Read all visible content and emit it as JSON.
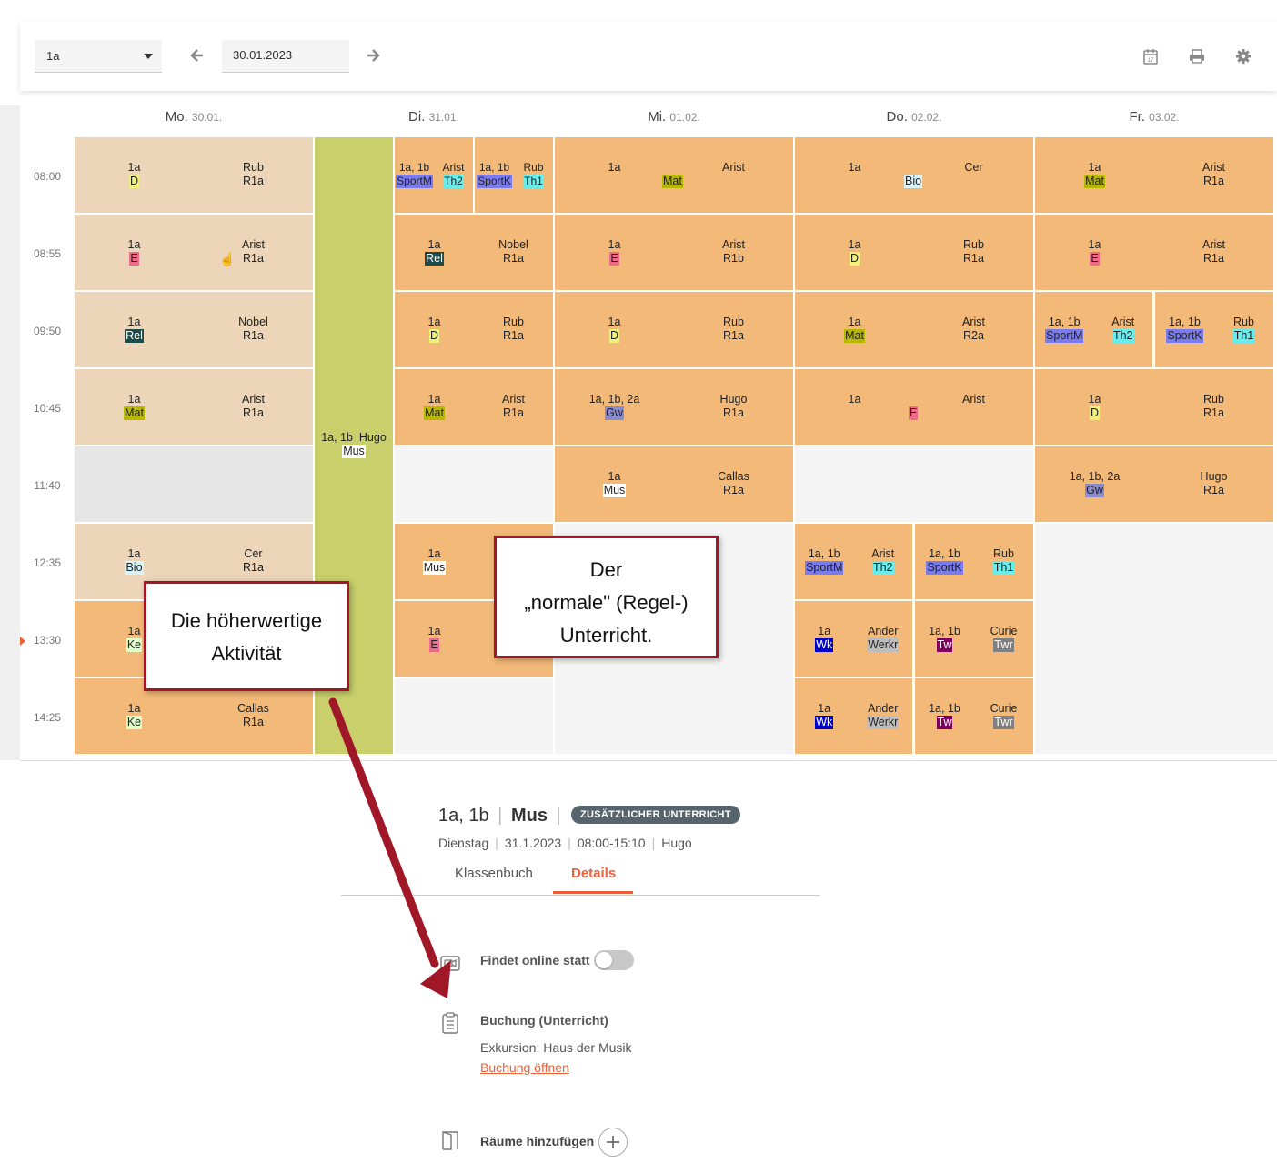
{
  "toolbar": {
    "class_value": "1a",
    "date_value": "30.01.2023",
    "icons": [
      "arrow-left-icon",
      "arrow-right-icon",
      "calendar-icon",
      "print-icon",
      "gear-icon"
    ]
  },
  "days": [
    {
      "name": "Mo.",
      "date": "30.01."
    },
    {
      "name": "Di.",
      "date": "31.01."
    },
    {
      "name": "Mi.",
      "date": "01.02."
    },
    {
      "name": "Do.",
      "date": "02.02."
    },
    {
      "name": "Fr.",
      "date": "03.02."
    }
  ],
  "times": [
    "08:00",
    "08:55",
    "09:50",
    "10:45",
    "11:40",
    "12:35",
    "13:30",
    "14:25"
  ],
  "lessons": {
    "mo": [
      {
        "cls": "1a",
        "subj": "D",
        "teacher": "Rub",
        "room": "R1a"
      },
      {
        "cls": "1a",
        "subj": "E",
        "teacher": "Arist",
        "room": "R1a"
      },
      {
        "cls": "1a",
        "subj": "Rel",
        "teacher": "Nobel",
        "room": "R1a"
      },
      {
        "cls": "1a",
        "subj": "Mat",
        "teacher": "Arist",
        "room": "R1a"
      },
      {
        "cls": "1a",
        "subj": "Bio",
        "teacher": "Cer",
        "room": "R1a"
      },
      {
        "cls": "1a",
        "subj": "Ke"
      },
      {
        "cls": "1a",
        "subj": "Ke",
        "teacher": "Callas",
        "room": "R1a"
      }
    ],
    "mo_extra": {
      "cls": "1a, 1b",
      "teacher": "Hugo",
      "subj": "Mus"
    },
    "di": [
      {
        "cls": "1a, 1b",
        "subj": "SportM",
        "teacher": "Arist",
        "room": "Th2"
      },
      {
        "cls": "1a, 1b",
        "subj": "SportK",
        "teacher": "Rub",
        "room": "Th1"
      },
      {
        "cls": "1a",
        "subj": "Rel",
        "teacher": "Nobel",
        "room": "R1a"
      },
      {
        "cls": "1a",
        "subj": "D",
        "teacher": "Rub",
        "room": "R1a"
      },
      {
        "cls": "1a",
        "subj": "Mat",
        "teacher": "Arist",
        "room": "R1a"
      },
      {
        "cls": "1a",
        "subj": "Mus"
      },
      {
        "cls": "1a",
        "subj": "E"
      }
    ],
    "mi": [
      {
        "cls": "1a",
        "subj": "Mat",
        "teacher": "Arist",
        "room": ""
      },
      {
        "cls": "1a",
        "subj": "E",
        "teacher": "Arist",
        "room": "R1b"
      },
      {
        "cls": "1a",
        "subj": "D",
        "teacher": "Rub",
        "room": "R1a"
      },
      {
        "cls": "1a, 1b, 2a",
        "subj": "Gw",
        "teacher": "Hugo",
        "room": "R1a"
      },
      {
        "cls": "1a",
        "subj": "Mus",
        "teacher": "Callas",
        "room": "R1a"
      }
    ],
    "do": [
      {
        "cls": "1a",
        "subj": "Bio",
        "teacher": "Cer",
        "room": ""
      },
      {
        "cls": "1a",
        "subj": "D",
        "teacher": "Rub",
        "room": "R1a"
      },
      {
        "cls": "1a",
        "subj": "Mat",
        "teacher": "Arist",
        "room": "R2a"
      },
      {
        "cls": "1a",
        "subj": "E",
        "teacher": "Arist",
        "room": ""
      },
      {
        "cls": "1a, 1b",
        "subj": "SportM",
        "teacher": "Arist",
        "room": "Th2"
      },
      {
        "cls": "1a, 1b",
        "subj": "SportK",
        "teacher": "Rub",
        "room": "Th1"
      },
      {
        "cls": "1a",
        "subj": "Wk",
        "teacher": "Ander",
        "room": "Werkr"
      },
      {
        "cls": "1a, 1b",
        "subj": "Tw",
        "teacher": "Curie",
        "room": "Twr"
      },
      {
        "cls": "1a",
        "subj": "Wk",
        "teacher": "Ander",
        "room": "Werkr"
      },
      {
        "cls": "1a, 1b",
        "subj": "Tw",
        "teacher": "Curie",
        "room": "Twr"
      }
    ],
    "fr": [
      {
        "cls": "1a",
        "subj": "Mat",
        "teacher": "Arist",
        "room": "R1a"
      },
      {
        "cls": "1a",
        "subj": "E",
        "teacher": "Arist",
        "room": "R1a"
      },
      {
        "cls": "1a, 1b",
        "subj": "SportM",
        "teacher": "Arist",
        "room": "Th2"
      },
      {
        "cls": "1a, 1b",
        "subj": "SportK",
        "teacher": "Rub",
        "room": "Th1"
      },
      {
        "cls": "1a",
        "subj": "D",
        "teacher": "Rub",
        "room": "R1a"
      },
      {
        "cls": "1a, 1b, 2a",
        "subj": "Gw",
        "teacher": "Hugo",
        "room": "R1a"
      }
    ]
  },
  "subject_colors": {
    "D": "#f0f07a",
    "E": "#f06a8a",
    "Rel": "#1f4a4a",
    "Mat": "#b8b800",
    "Bio": "#d8f4f8",
    "Ke": "#e0ffcc",
    "Mus": "#ffffff",
    "SportM": "#7b7bf0",
    "SportK": "#7b7bf0",
    "Th1": "#66eeee",
    "Th2": "#66eeee",
    "Gw": "#8a8ad0",
    "Wk": "#0000cc",
    "Tw": "#800060",
    "Werkr": "#bdbdbd",
    "Twr": "#808080"
  },
  "callouts": {
    "left_line1": "Die höherwertige",
    "left_line2": "Aktivität",
    "right_line1": "Der",
    "right_line2": "„normale\" (Regel-)",
    "right_line3": "Unterricht."
  },
  "detail": {
    "title_classes": "1a, 1b",
    "title_subject": "Mus",
    "badge": "ZUSÄTZLICHER UNTERRICHT",
    "day": "Dienstag",
    "date": "31.1.2023",
    "time": "08:00-15:10",
    "teacher": "Hugo",
    "tab_classbook": "Klassenbuch",
    "tab_details": "Details",
    "online_label": "Findet online statt",
    "booking_title": "Buchung (Unterricht)",
    "booking_text": "Exkursion: Haus der Musik",
    "booking_link": "Buchung öffnen",
    "rooms_label": "Räume hinzufügen"
  }
}
